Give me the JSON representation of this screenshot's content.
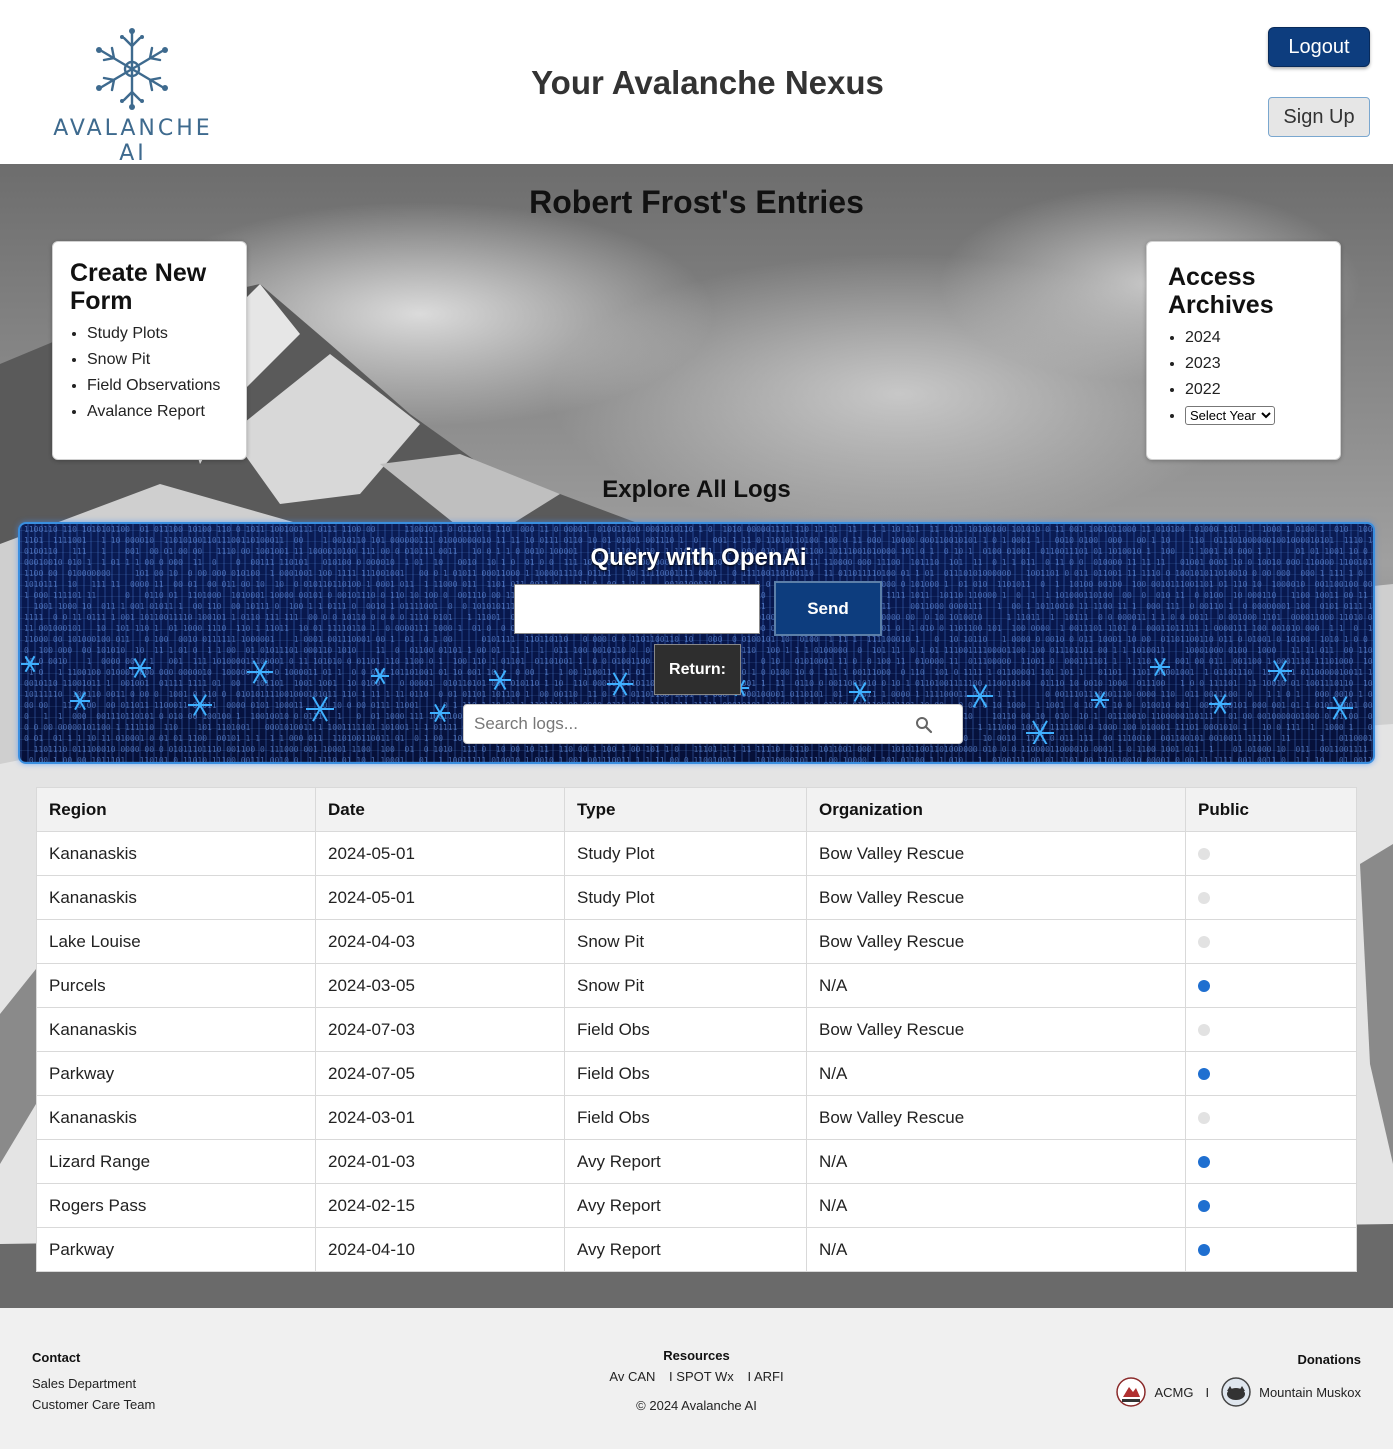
{
  "header": {
    "logo_text": "AVALANCHE AI",
    "site_title": "Your Avalanche Nexus",
    "logout_label": "Logout",
    "signup_label": "Sign Up"
  },
  "main": {
    "page_heading": "Robert Frost's Entries",
    "create_card": {
      "title": "Create New Form",
      "items": [
        "Study Plots",
        "Snow Pit",
        "Field Observations",
        "Avalance Report"
      ]
    },
    "archive_card": {
      "title": "Access Archives",
      "items": [
        "2024",
        "2023",
        "2022"
      ],
      "select_placeholder": "Select Year"
    },
    "explore_title": "Explore All Logs",
    "query": {
      "title": "Query with OpenAi",
      "input_value": "",
      "send_label": "Send",
      "return_label": "Return:",
      "search_placeholder": "Search logs..."
    },
    "table": {
      "columns": [
        "Region",
        "Date",
        "Type",
        "Organization",
        "Public"
      ],
      "rows": [
        {
          "region": "Kananaskis",
          "date": "2024-05-01",
          "type": "Study Plot",
          "org": "Bow Valley Rescue",
          "public": false
        },
        {
          "region": "Kananaskis",
          "date": "2024-05-01",
          "type": "Study Plot",
          "org": "Bow Valley Rescue",
          "public": false
        },
        {
          "region": "Lake Louise",
          "date": "2024-04-03",
          "type": "Snow Pit",
          "org": "Bow Valley Rescue",
          "public": false
        },
        {
          "region": "Purcels",
          "date": "2024-03-05",
          "type": "Snow Pit",
          "org": "N/A",
          "public": true
        },
        {
          "region": "Kananaskis",
          "date": "2024-07-03",
          "type": "Field Obs",
          "org": "Bow Valley Rescue",
          "public": false
        },
        {
          "region": "Parkway",
          "date": "2024-07-05",
          "type": "Field Obs",
          "org": "N/A",
          "public": true
        },
        {
          "region": "Kananaskis",
          "date": "2024-03-01",
          "type": "Field Obs",
          "org": "Bow Valley Rescue",
          "public": false
        },
        {
          "region": "Lizard Range",
          "date": "2024-01-03",
          "type": "Avy Report",
          "org": "N/A",
          "public": true
        },
        {
          "region": "Rogers Pass",
          "date": "2024-02-15",
          "type": "Avy Report",
          "org": "N/A",
          "public": true
        },
        {
          "region": "Parkway",
          "date": "2024-04-10",
          "type": "Avy Report",
          "org": "N/A",
          "public": true
        }
      ]
    }
  },
  "footer": {
    "contact_heading": "Contact",
    "contact_links": [
      "Sales Department",
      "Customer Care Team"
    ],
    "resources_heading": "Resources",
    "resource_links": [
      "Av CAN",
      "I SPOT Wx",
      "I ARFI"
    ],
    "copyright": "© 2024 Avalanche AI",
    "donations_heading": "Donations",
    "donation_links": [
      "ACMG",
      "Mountain Muskox"
    ],
    "donation_separator": "I"
  },
  "colors": {
    "brand_blue": "#0d3d7e",
    "logo_blue": "#3e6a8e",
    "public_on": "#1f6fd0",
    "public_off": "#e2e2e2"
  }
}
